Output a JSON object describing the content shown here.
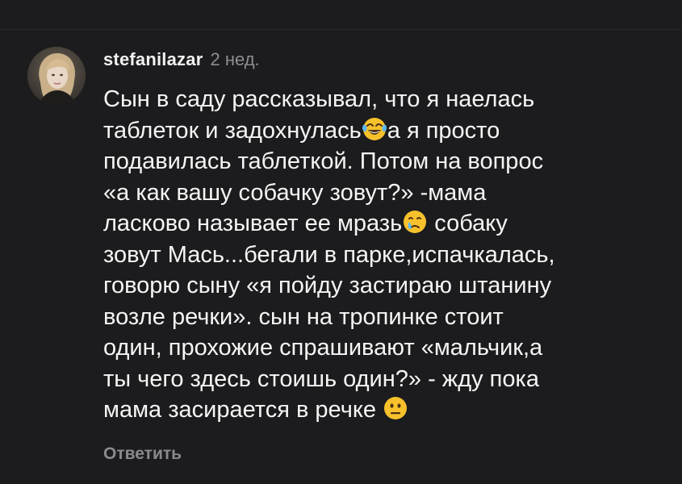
{
  "comment": {
    "username": "stefanilazar",
    "time": "2 нед.",
    "lines": {
      "l1": "Сын в саду рассказывал, что я наелась",
      "l2a": "таблеток и задохнулась",
      "l2b": "а я просто",
      "l3": "подавилась таблеткой. Потом на вопрос",
      "l4": "«а как вашу собачку зовут?» -мама",
      "l5a": "ласково называет ее мразь",
      "l5b": " собаку",
      "l6": "зовут Мась...бегали в парке,испачкалась,",
      "l7": "говорю сыну «я пойду застираю штанину",
      "l8": "возле речки». сын на тропинке стоит",
      "l9": "один, прохожие спрашивают «мальчик,а",
      "l10": "ты чего здесь стоишь один?» - жду пока",
      "l11": "мама засирается  в речке "
    },
    "emojis": [
      "face-with-tears-of-joy-icon",
      "crying-face-icon",
      "neutral-face-icon"
    ],
    "reply_label": "Ответить"
  },
  "colors": {
    "background": "#1c1c1e",
    "primary_text": "#f5f5f5",
    "secondary_text": "#8e8e93",
    "emoji_yellow": "#f7c12c"
  }
}
